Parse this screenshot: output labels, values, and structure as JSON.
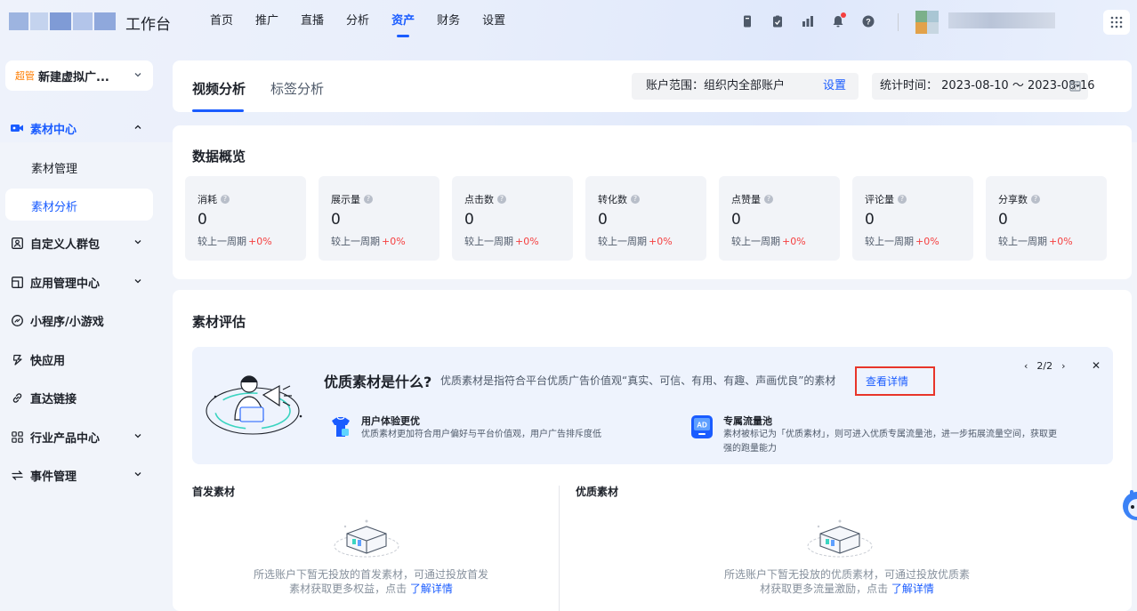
{
  "brand": {
    "name": "工作台"
  },
  "nav": {
    "items": [
      "首页",
      "推广",
      "直播",
      "分析",
      "资产",
      "财务",
      "设置"
    ],
    "active": "资产"
  },
  "header_icons": [
    "document-icon",
    "clipboard-icon",
    "chart-icon",
    "bell-icon",
    "help-icon"
  ],
  "sidebar": {
    "account": {
      "tag": "超管",
      "name": "新建虚拟广..."
    },
    "items": [
      {
        "label": "素材中心",
        "icon": "video-icon",
        "expanded": true
      },
      {
        "label": "自定义人群包",
        "icon": "audience-icon"
      },
      {
        "label": "应用管理中心",
        "icon": "app-icon"
      },
      {
        "label": "小程序/小游戏",
        "icon": "miniprogram-icon"
      },
      {
        "label": "快应用",
        "icon": "quickapp-icon"
      },
      {
        "label": "直达链接",
        "icon": "link-icon"
      },
      {
        "label": "行业产品中心",
        "icon": "grid-icon"
      },
      {
        "label": "事件管理",
        "icon": "event-icon"
      }
    ],
    "sub_items": [
      "素材管理",
      "素材分析"
    ],
    "active_sub": "素材分析"
  },
  "tabs": {
    "items": [
      "视频分析",
      "标签分析"
    ],
    "active": "视频分析"
  },
  "filters": {
    "account_range_label": "账户范围：组织内全部账户",
    "account_range_action": "设置",
    "time_label": "统计时间：",
    "date_range": "2023-08-10 ～ 2023-08-16"
  },
  "overview": {
    "title": "数据概览",
    "compare_label": "较上一周期",
    "metrics": [
      {
        "label": "消耗",
        "value": "0",
        "change": "+0%"
      },
      {
        "label": "展示量",
        "value": "0",
        "change": "+0%"
      },
      {
        "label": "点击数",
        "value": "0",
        "change": "+0%"
      },
      {
        "label": "转化数",
        "value": "0",
        "change": "+0%"
      },
      {
        "label": "点赞量",
        "value": "0",
        "change": "+0%"
      },
      {
        "label": "评论量",
        "value": "0",
        "change": "+0%"
      },
      {
        "label": "分享数",
        "value": "0",
        "change": "+0%"
      }
    ]
  },
  "evaluation": {
    "title": "素材评估",
    "banner": {
      "title": "优质素材是什么?",
      "desc": "优质素材是指符合平台优质广告价值观“真实、可信、有用、有趣、声画优良”的素材",
      "link": "查看详情",
      "page": "2/2",
      "features": [
        {
          "title": "用户体验更优",
          "desc": "优质素材更加符合用户偏好与平台价值观，用户广告排斥度低"
        },
        {
          "title": "专属流量池",
          "desc": "素材被标记为「优质素材」，则可进入优质专属流量池，进一步拓展流量空间，获取更强的跑量能力",
          "badge": "AD"
        }
      ]
    },
    "columns": [
      {
        "title": "首发素材",
        "empty_text": "所选账户下暂无投放的首发素材，可通过投放首发素材获取更多权益，点击",
        "link": "了解详情"
      },
      {
        "title": "优质素材",
        "empty_text": "所选账户下暂无投放的优质素材，可通过投放优质素材获取更多流量激励，点击",
        "link": "了解详情"
      }
    ]
  },
  "colors": {
    "accent": "#1a5cff",
    "positive_change": "#f53f3f",
    "highlight_border": "#e8352a"
  }
}
